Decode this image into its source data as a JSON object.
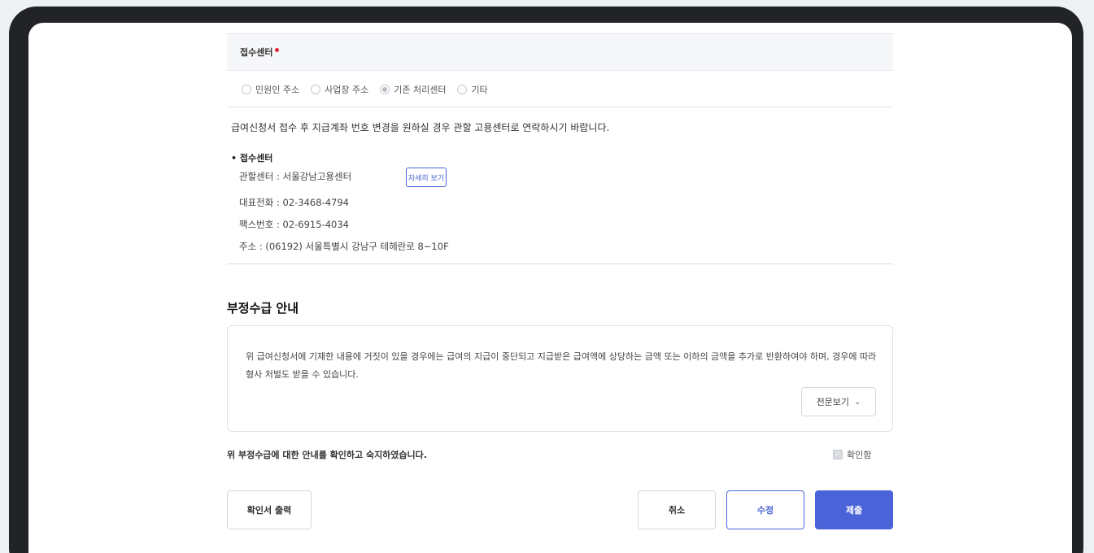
{
  "receipt": {
    "section_title": "접수센터",
    "options": [
      {
        "label": "민원인 주소",
        "selected": false
      },
      {
        "label": "사업장 주소",
        "selected": false
      },
      {
        "label": "기존 처리센터",
        "selected": true
      },
      {
        "label": "기타",
        "selected": false
      }
    ],
    "notice": "급여신청서 접수 후 지급계좌 번호 변경을 원하실 경우 관할 고용센터로 연락하시기 바랍니다.",
    "center_title": "• 접수센터",
    "jurisdiction": "관할센터 : 서울강남고용센터",
    "detail_button": "자세히 보기",
    "phone": "대표전화 : 02-3468-4794",
    "fax": "팩스번호 : 02-6915-4034",
    "address": "주소 : (06192) 서울특별시 강남구 테헤란로 8~10F"
  },
  "fraud": {
    "heading": "부정수급 안내",
    "text": "위 급여신청서에 기재한 내용에 거짓이 있을 경우에는 급여의 지급이 중단되고 지급받은 급여액에 상당하는 금액 또는 이하의 금액을 추가로 반환하여야 하며, 경우에 따라 형사 처벌도 받을 수 있습니다.",
    "full_view_button": "전문보기",
    "agree_text": "위 부정수급에 대한 안내를 확인하고 숙지하였습니다.",
    "confirm_label": "확인함"
  },
  "actions": {
    "print": "확인서 출력",
    "cancel": "취소",
    "edit": "수정",
    "submit": "제출"
  },
  "colors": {
    "accent": "#4a63d8",
    "required": "#e2253b",
    "frame": "#222326"
  }
}
